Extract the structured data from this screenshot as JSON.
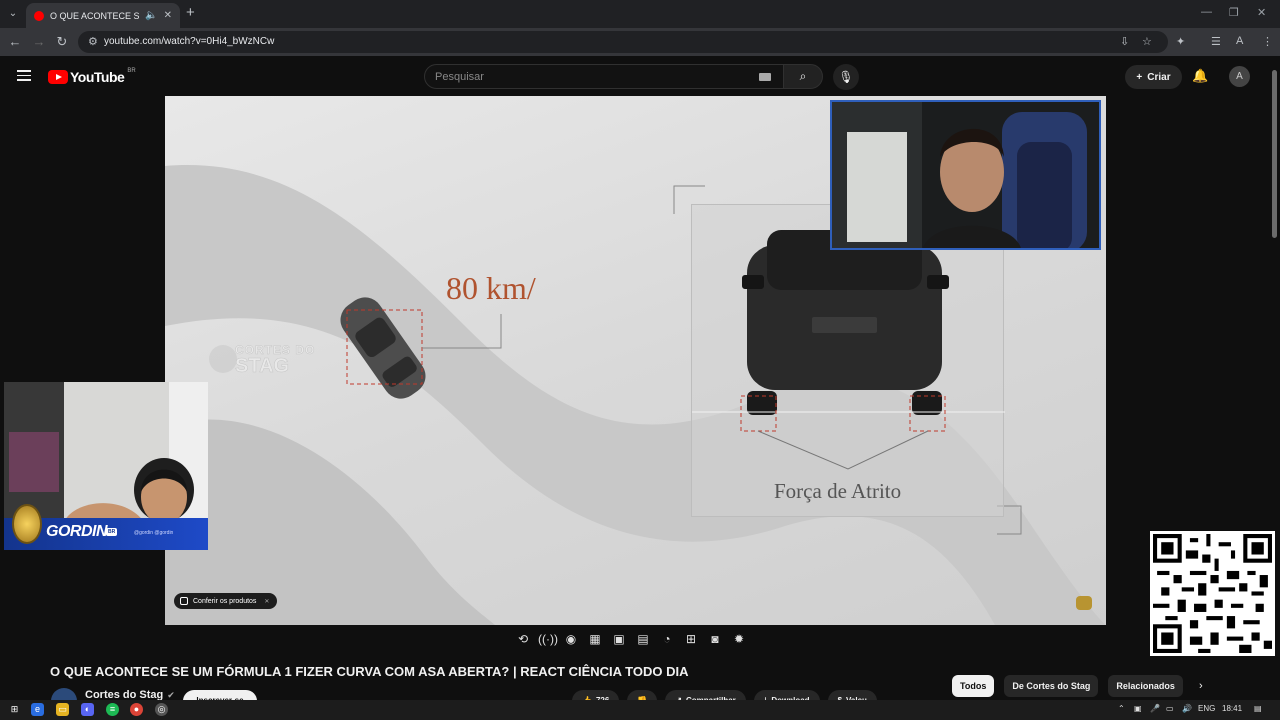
{
  "browser": {
    "tab_title": "O QUE ACONTECE SE UM F",
    "address_url": "youtube.com/watch?v=0Hi4_bWzNCw"
  },
  "youtube": {
    "logo_text": "YouTube",
    "region": "BR",
    "search_placeholder": "Pesquisar",
    "create_label": "Criar"
  },
  "video": {
    "speed_text": "80 km/",
    "force_label": "Força de Atrito",
    "watermark_line1": "CORTES DO",
    "watermark_line2": "STAG",
    "products_label": "Conferir os produtos",
    "streamer_name": "GORDIN",
    "streamer_tag": "BR",
    "streamer_handles": "@gordin  @gordin"
  },
  "info": {
    "title": "O QUE ACONTECE SE UM FÓRMULA 1 FIZER CURVA COM ASA ABERTA? | REACT CIÊNCIA TODO DIA",
    "channel_name": "Cortes do Stag",
    "subscribe_label": "Inscrever-se",
    "actions": [
      "726",
      "",
      "Compartilhar",
      "Download",
      "Valeu"
    ]
  },
  "chips": [
    "Todos",
    "De Cortes do Stag",
    "Relacionados"
  ],
  "taskbar": {
    "lang": "ENG",
    "time": "18:41"
  },
  "icons": {
    "tab_menu": "chevron-down-icon",
    "back": "arrow-left-icon",
    "forward": "arrow-right-icon",
    "reload": "reload-icon",
    "search": "search-icon",
    "mic": "mic-icon",
    "bell": "bell-icon"
  },
  "colors": {
    "youtube_red": "#ff0000",
    "speed_text": "#b0532f",
    "facecam_border": "#2f5fbb",
    "gordin_bar": "#13348c"
  }
}
